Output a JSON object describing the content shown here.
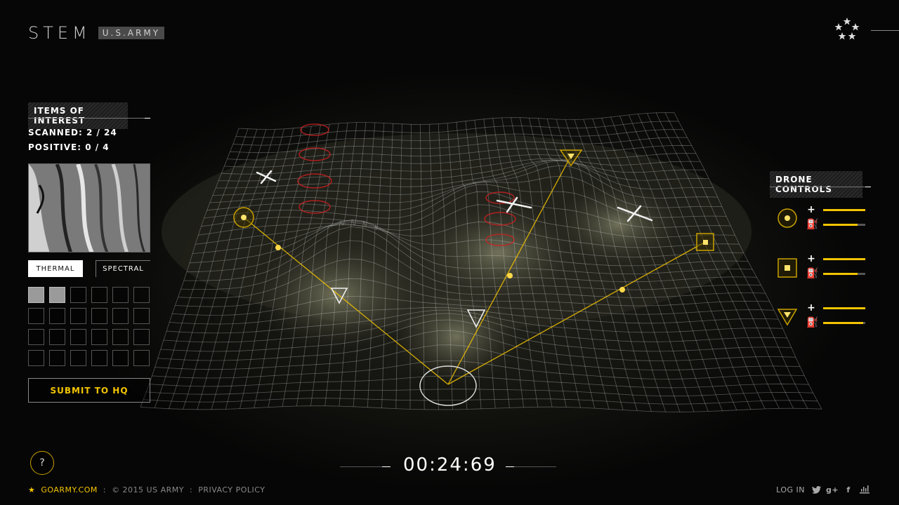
{
  "brand": {
    "stem": "STEM",
    "army": "U.S.ARMY"
  },
  "items_panel": {
    "title": "ITEMS OF INTEREST",
    "scanned": "SCANNED: 2 / 24",
    "positive": "POSITIVE: 0 / 4",
    "modes": [
      "THERMAL",
      "SPECTRAL"
    ],
    "active_mode": "THERMAL",
    "scanned_count": 2,
    "grid_total": 24,
    "submit_label": "SUBMIT TO HQ"
  },
  "drone_panel": {
    "title": "DRONE CONTROLS",
    "drones": [
      {
        "icon": "circle-drone-icon",
        "altitude_level": 1.0,
        "fuel_level": 0.82
      },
      {
        "icon": "square-drone-icon",
        "altitude_level": 1.0,
        "fuel_level": 0.82
      },
      {
        "icon": "triangle-drone-icon",
        "altitude_level": 1.0,
        "fuel_level": 0.95
      }
    ]
  },
  "timer": {
    "value": "00:24:69"
  },
  "help": {
    "label": "?"
  },
  "footer": {
    "site": "GOARMY.COM",
    "copyright": "© 2015 US ARMY",
    "privacy": "PRIVACY POLICY",
    "login": "LOG IN",
    "social": [
      "twitter-icon",
      "google-plus-icon",
      "facebook-icon",
      "share-icon"
    ]
  },
  "colors": {
    "accent": "#f3c400",
    "background": "#050505",
    "panel_text": "#ffffff"
  }
}
